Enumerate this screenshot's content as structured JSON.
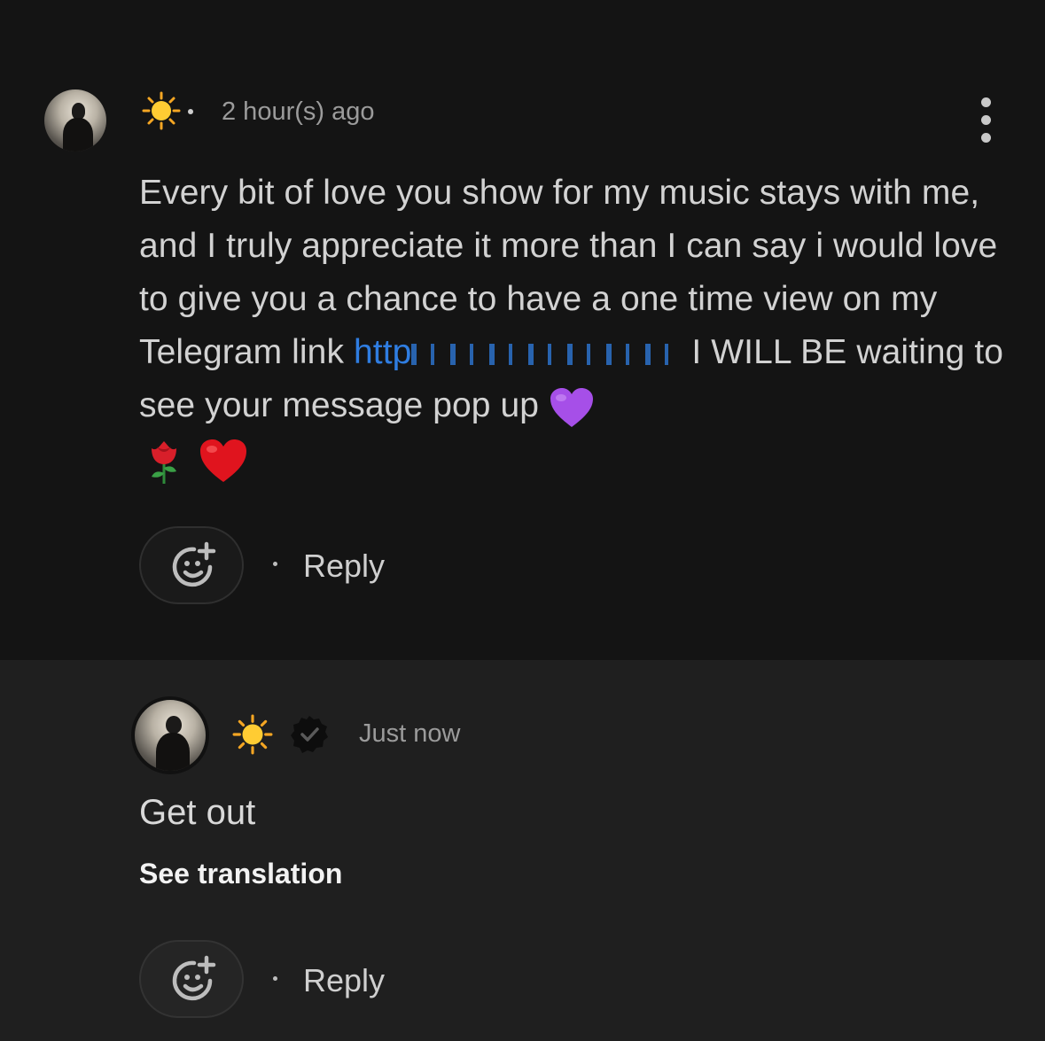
{
  "comment": {
    "username_icon": "sun-emoji",
    "timestamp": "2 hour(s) ago",
    "text_before_link": "Every bit of love you show for my music stays with me, and I truly appreciate it more than I can say i would love to give you a chance to have a one time view on my Telegram link ",
    "link_visible": "http",
    "text_after_link": " I WILL BE waiting to see your message pop up ",
    "emoji_after_text": "purple-heart",
    "trailing_emojis": [
      "rose",
      "red-heart"
    ],
    "reply_label": "Reply",
    "react_icon": "add-reaction-icon"
  },
  "reply": {
    "username_icon": "sun-emoji",
    "badge_icon": "verified-badge-icon",
    "timestamp": "Just now",
    "text": "Get out",
    "translation_label": "See translation",
    "reply_label": "Reply",
    "react_icon": "add-reaction-icon"
  },
  "colors": {
    "background_top": "#141414",
    "background_reply": "#1f1f1f",
    "link": "#2f7de1"
  }
}
